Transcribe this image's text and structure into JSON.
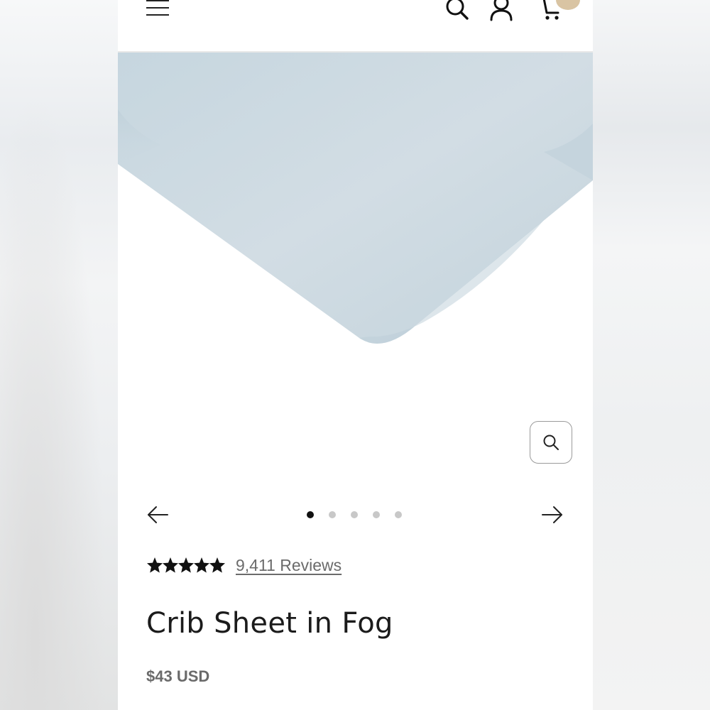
{
  "header": {
    "menu_icon": "hamburger-menu-icon",
    "search_icon": "search-icon",
    "account_icon": "account-icon",
    "cart_icon": "cart-icon",
    "cart_badge_color": "#d9c4a3"
  },
  "gallery": {
    "sheet_color": "#c9d8e1",
    "zoom_icon": "zoom-icon",
    "prev_icon": "arrow-left-icon",
    "next_icon": "arrow-right-icon",
    "slide_count": 5,
    "active_slide": 1
  },
  "product": {
    "rating": 5,
    "reviews_label": "9,411 Reviews",
    "title": "Crib Sheet in Fog",
    "price": "$43 USD"
  }
}
